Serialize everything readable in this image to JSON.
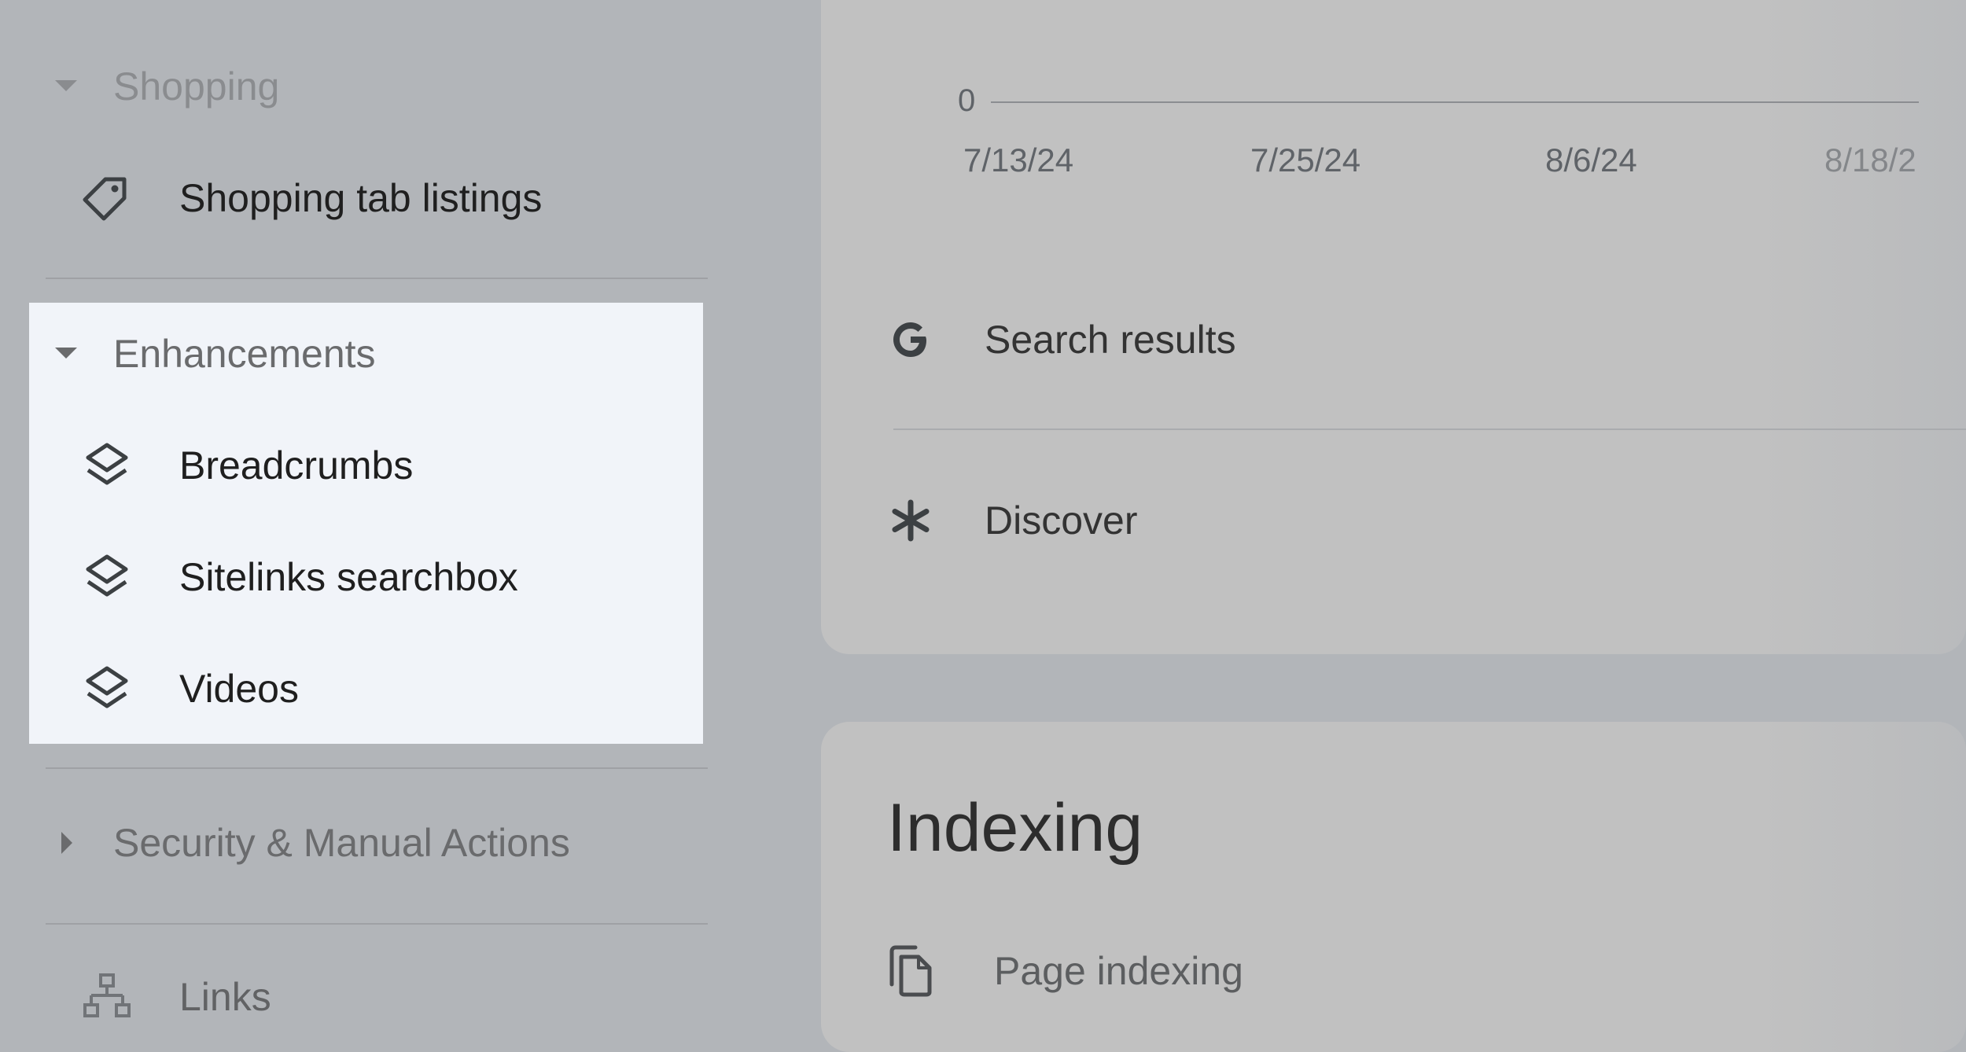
{
  "sidebar": {
    "shopping": {
      "section_title": "Shopping",
      "items": [
        {
          "label": "Shopping tab listings",
          "icon": "tag-icon"
        }
      ]
    },
    "enhancements": {
      "section_title": "Enhancements",
      "items": [
        {
          "label": "Breadcrumbs",
          "icon": "layers-icon"
        },
        {
          "label": "Sitelinks searchbox",
          "icon": "layers-icon"
        },
        {
          "label": "Videos",
          "icon": "layers-icon"
        }
      ]
    },
    "security": {
      "section_title": "Security & Manual Actions"
    },
    "links": {
      "label": "Links",
      "icon": "sitemap-icon"
    }
  },
  "performance_card": {
    "chart_data": {
      "type": "line",
      "y_tick": "0",
      "x_ticks": [
        "7/13/24",
        "7/25/24",
        "8/6/24",
        "8/18/2"
      ]
    },
    "rows": [
      {
        "label": "Search results",
        "icon": "google-g-icon"
      },
      {
        "label": "Discover",
        "icon": "asterisk-icon"
      }
    ]
  },
  "indexing_card": {
    "title": "Indexing",
    "items": [
      {
        "label": "Page indexing",
        "icon": "copy-pages-icon"
      }
    ]
  },
  "colors": {
    "overlay_background": "#b2b5b9",
    "highlight_background": "#f1f4f9",
    "card_background": "#c1c1c1"
  }
}
